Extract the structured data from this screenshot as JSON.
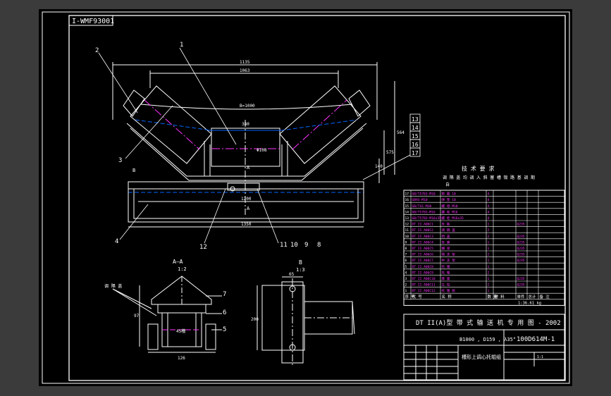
{
  "drawing_id": "I-WMF93001",
  "callouts": [
    "1",
    "2",
    "3",
    "4",
    "5",
    "6",
    "7",
    "8",
    "9",
    "10",
    "11",
    "12",
    "13",
    "14",
    "15",
    "16",
    "17"
  ],
  "dims": {
    "overall_1": "1135",
    "overall_2": "1063",
    "belt_b": "B=1000",
    "center": "380",
    "height_r": "564",
    "small_v": "575",
    "base_w": "1350",
    "base_in": "1200",
    "foot_v": "140",
    "roller_d": "Φ108",
    "mid_v": "380",
    "sec_a": "A",
    "sec_b": "B"
  },
  "detail_a": {
    "title": "A—A",
    "scale": "1:2",
    "dim_w": "126",
    "dim_h": "97",
    "label": "45槽",
    "note": "调 隔 盖"
  },
  "detail_b": {
    "title": "B",
    "scale": "1:3",
    "dim_h": "200",
    "dim_w": "65"
  },
  "tech_req": {
    "heading": "技 术 要 求",
    "line1": "调 隔 盖 均 调 入 斜 塞 槽 锻 路 基 调 期",
    "line2": "自"
  },
  "bom_rows": [
    [
      "17",
      "GB/T5783-M10",
      "垫  圈 10",
      "4",
      "",
      "",
      "",
      ""
    ],
    [
      "16",
      "GB93-M10",
      "弹 垫 10",
      "4",
      "",
      "",
      "",
      ""
    ],
    [
      "15",
      "GB/T41-M10",
      "螺  母 M10",
      "4",
      "",
      "",
      "",
      ""
    ],
    [
      "14",
      "GB/T5783-M16",
      "螺  栓 M16",
      "4",
      "",
      "",
      "",
      ""
    ],
    [
      "13",
      "GB/T5783-M16x35",
      "螺  栓 M16x35",
      "4",
      "",
      "",
      "",
      ""
    ],
    [
      "12",
      "DT II A06C1",
      "支  板",
      "1",
      "",
      "Q235",
      "",
      ""
    ],
    [
      "11",
      "DT II A06C2",
      "调 隔 盖",
      "2",
      "",
      "",
      "",
      ""
    ],
    [
      "10",
      "DT II A06C3",
      "挡  盖",
      "2",
      "",
      "Q235",
      "",
      ""
    ],
    [
      "9",
      "DT II A06C4",
      "支  座",
      "1",
      "",
      "Q235",
      "",
      ""
    ],
    [
      "8",
      "DT II A06C5",
      "横  梁",
      "1",
      "",
      "Q235",
      "",
      ""
    ],
    [
      "7",
      "DT II A06C6",
      "侧 支 架",
      "2",
      "",
      "Q235",
      "",
      ""
    ],
    [
      "6",
      "DT II A06C7",
      "中 支 架",
      "1",
      "",
      "Q235",
      "",
      ""
    ],
    [
      "5",
      "DT II A06C8",
      "托  辊",
      "1",
      "",
      "",
      "",
      ""
    ],
    [
      "4",
      "DT II A06C9",
      "托  辊",
      "2",
      "",
      "",
      "",
      ""
    ],
    [
      "3",
      "DT II A06C10",
      "底  座",
      "1",
      "",
      "Q235",
      "",
      ""
    ],
    [
      "2",
      "DT II A06C11",
      "立  柱",
      "2",
      "",
      "Q235",
      "",
      ""
    ],
    [
      "1",
      "DT II A06C12",
      "托 辊 组",
      "1",
      "",
      "",
      "",
      ""
    ]
  ],
  "bom_header": [
    "序 号",
    "代 号",
    "名 称",
    "数 量",
    "材 料",
    "单件",
    "总计",
    "备 注"
  ],
  "bom_mass": "1:36.61 kg",
  "title_block": {
    "series": "DT II(A)型  带 式 输 送 机 专 用 图 - 2002",
    "spec": "B1000 , D159 , λ35°",
    "drawing_no": "100D614M-1",
    "name": "槽形上调心托辊组",
    "page": "1:1"
  }
}
